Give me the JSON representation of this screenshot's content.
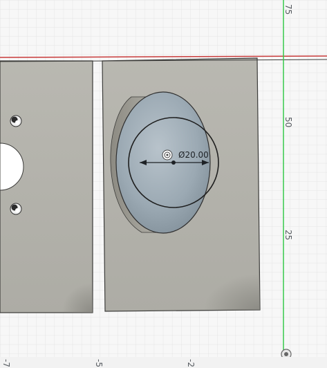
{
  "viewport": {
    "grid_visible": true,
    "background_color": "#f7f7f7",
    "grid_color": "#dcdcdc",
    "body_color": "#b6b5ae",
    "hole_color": "#9aa8b2",
    "y_axis_color": "#36c84a",
    "x_axis_color": "#c83a3a"
  },
  "y_axis": {
    "tick_labels": [
      "75",
      "50",
      "25"
    ]
  },
  "x_axis": {
    "tick_labels": [
      "-7",
      "-5",
      "-2"
    ]
  },
  "dimension": {
    "label": "Ø20.00",
    "icon": "concentric-circles-icon"
  }
}
